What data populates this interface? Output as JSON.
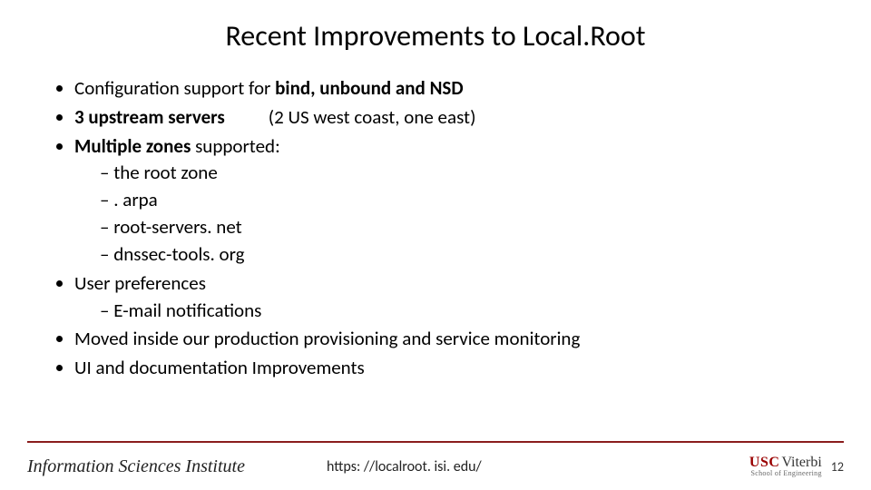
{
  "title": "Recent Improvements to Local.Root",
  "bullets": {
    "b1_prefix": "Configuration support for ",
    "b1_bold": "bind, unbound and NSD",
    "b2_bold": "3 upstream servers",
    "b2_suffix": "(2 US west coast, one east)",
    "b3_bold": "Multiple zones",
    "b3_suffix": " supported:",
    "b3_sub1": "the root zone",
    "b3_sub2": ". arpa",
    "b3_sub3": "root-servers. net",
    "b3_sub4": "dnssec-tools. org",
    "b4": "User preferences",
    "b4_sub1": "E-mail notifications",
    "b5": "Moved inside our production provisioning and service monitoring",
    "b6": "UI and documentation Improvements"
  },
  "footer": {
    "isi": "Information Sciences Institute",
    "url": "https: //localroot. isi. edu/",
    "page": "12",
    "logo_usc": "USC",
    "logo_viterbi": "Viterbi",
    "logo_school": "School of Engineering"
  }
}
